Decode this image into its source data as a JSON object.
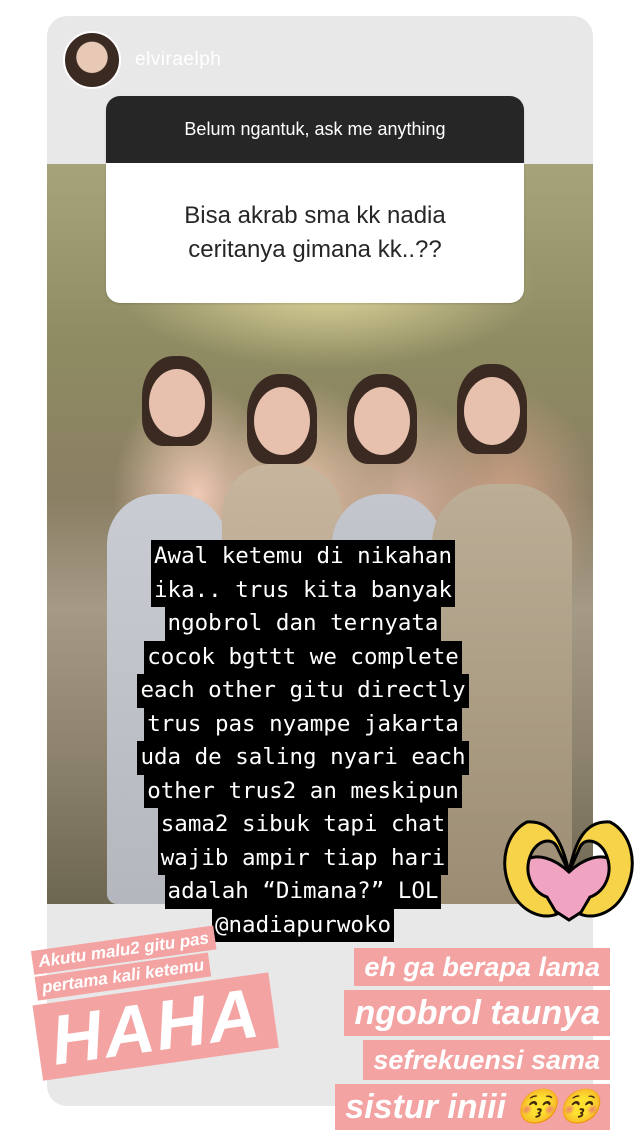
{
  "story": {
    "username": "elviraelph",
    "avatar": "profile-avatar"
  },
  "question_sticker": {
    "prompt": "Belum ngantuk, ask me anything",
    "question_line1": "Bisa akrab sma kk nadia",
    "question_line2": "ceritanya gimana kk..??"
  },
  "answer": {
    "lines": [
      "Awal ketemu di nikahan",
      "ika.. trus kita banyak",
      "ngobrol dan ternyata",
      "cocok bgttt we complete",
      "each other gitu directly",
      "trus pas nyampe jakarta",
      "uda de saling nyari each",
      "other trus2 an meskipun",
      "sama2 sibuk tapi chat",
      "wajib ampir tiap hari",
      "adalah “Dimana?” LOL",
      "@nadiapurwoko"
    ]
  },
  "stickers": {
    "left_line1": "Akutu malu2 gitu pas",
    "left_line2": "pertama kali ketemu",
    "left_big": "HAHA",
    "right_line1": "eh ga berapa lama",
    "right_line2": "ngobrol taunya",
    "right_line3": "sefrekuensi sama",
    "right_line4": "sistur iniii 😚😚"
  },
  "icons": {
    "heart_hands": "heart-hands-icon"
  },
  "colors": {
    "sticker_pink": "#f4a3a3",
    "question_header_bg": "#262626",
    "heart_hands_yellow": "#f7d34a",
    "heart_pink": "#f1a3c2"
  }
}
